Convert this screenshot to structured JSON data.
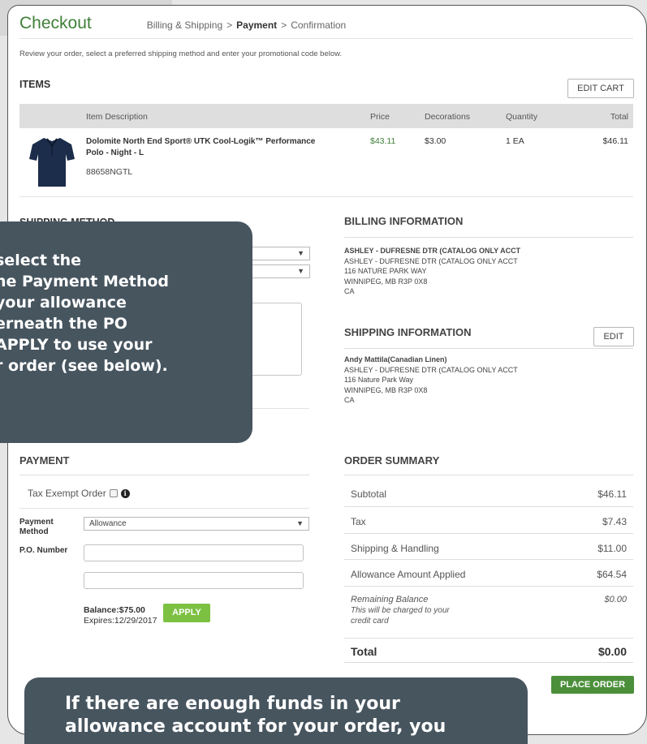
{
  "header": {
    "title": "Checkout",
    "crumbs": [
      "Billing & Shipping",
      "Payment",
      "Confirmation"
    ],
    "crumb_separator": ">"
  },
  "intro": "Review your order, select a preferred shipping method and enter your promotional code below.",
  "items": {
    "heading": "ITEMS",
    "edit_cart_label": "EDIT CART",
    "columns": [
      "Item Description",
      "Price",
      "Decorations",
      "Quantity",
      "Total"
    ],
    "rows": [
      {
        "name": "Dolomite North End Sport® UTK Cool-Logik™ Performance Polo - Night - L",
        "sku": "88658NGTL",
        "price": "$43.11",
        "decorations": "$3.00",
        "quantity": "1 EA",
        "total": "$46.11",
        "thumbnail_icon": "navy-polo-shirt-icon"
      }
    ]
  },
  "shipping_method": {
    "heading": "SHIPPING METHOD",
    "dropdown_arrow": "▼"
  },
  "billing": {
    "heading": "BILLING INFORMATION",
    "lines": [
      "ASHLEY - DUFRESNE DTR (CATALOG ONLY ACCT",
      "ASHLEY - DUFRESNE DTR (CATALOG ONLY ACCT",
      "116 NATURE PARK WAY",
      "WINNIPEG, MB R3P 0X8",
      "CA"
    ]
  },
  "shipping_info": {
    "heading": "SHIPPING INFORMATION",
    "edit_label": "EDIT",
    "lines": [
      "Andy Mattila(Canadian Linen)",
      "ASHLEY - DUFRESNE DTR (CATALOG ONLY ACCT",
      "116 Nature Park Way",
      "WINNIPEG, MB R3P 0X8",
      "CA"
    ]
  },
  "payment": {
    "heading": "PAYMENT",
    "tax_exempt_label": "Tax Exempt Order",
    "tax_exempt_checked": false,
    "info_glyph": "i",
    "payment_method_label": "Payment Method",
    "payment_method_value": "Allowance",
    "dropdown_arrow": "▼",
    "po_number_label": "P.O. Number",
    "po_number_value": "",
    "second_field_value": "",
    "balance": "Balance:$75.00",
    "expires": "Expires:12/29/2017",
    "apply_label": "APPLY"
  },
  "summary": {
    "heading": "ORDER SUMMARY",
    "subtotal_label": "Subtotal",
    "subtotal": "$46.11",
    "tax_label": "Tax",
    "tax": "$7.43",
    "shipping_label": "Shipping & Handling",
    "shipping": "$11.00",
    "allowance_label": "Allowance Amount Applied",
    "allowance": "$64.54",
    "remaining_label": "Remaining Balance",
    "remaining_sub1": "This will be charged to your",
    "remaining_sub2": "credit card",
    "remaining": "$0.00",
    "total_label": "Total",
    "total": "$0.00",
    "place_order_label": "PLACE ORDER"
  },
  "overlay_top": {
    "lines": [
      "select the",
      "ne Payment Method",
      "your allowance",
      "erneath the PO",
      "r order (see below)."
    ],
    "line5_bold": "APPLY",
    "line5_prefix": "",
    "line5_suffix": " to use your"
  },
  "overlay_bottom": {
    "lines": [
      "If there are enough funds in your",
      "allowance account for your order, you"
    ]
  },
  "colors": {
    "brand_green": "#3f7f38",
    "apply_green": "#7cc142",
    "place_order_green": "#4b8f3a",
    "overlay": "#47555f"
  }
}
